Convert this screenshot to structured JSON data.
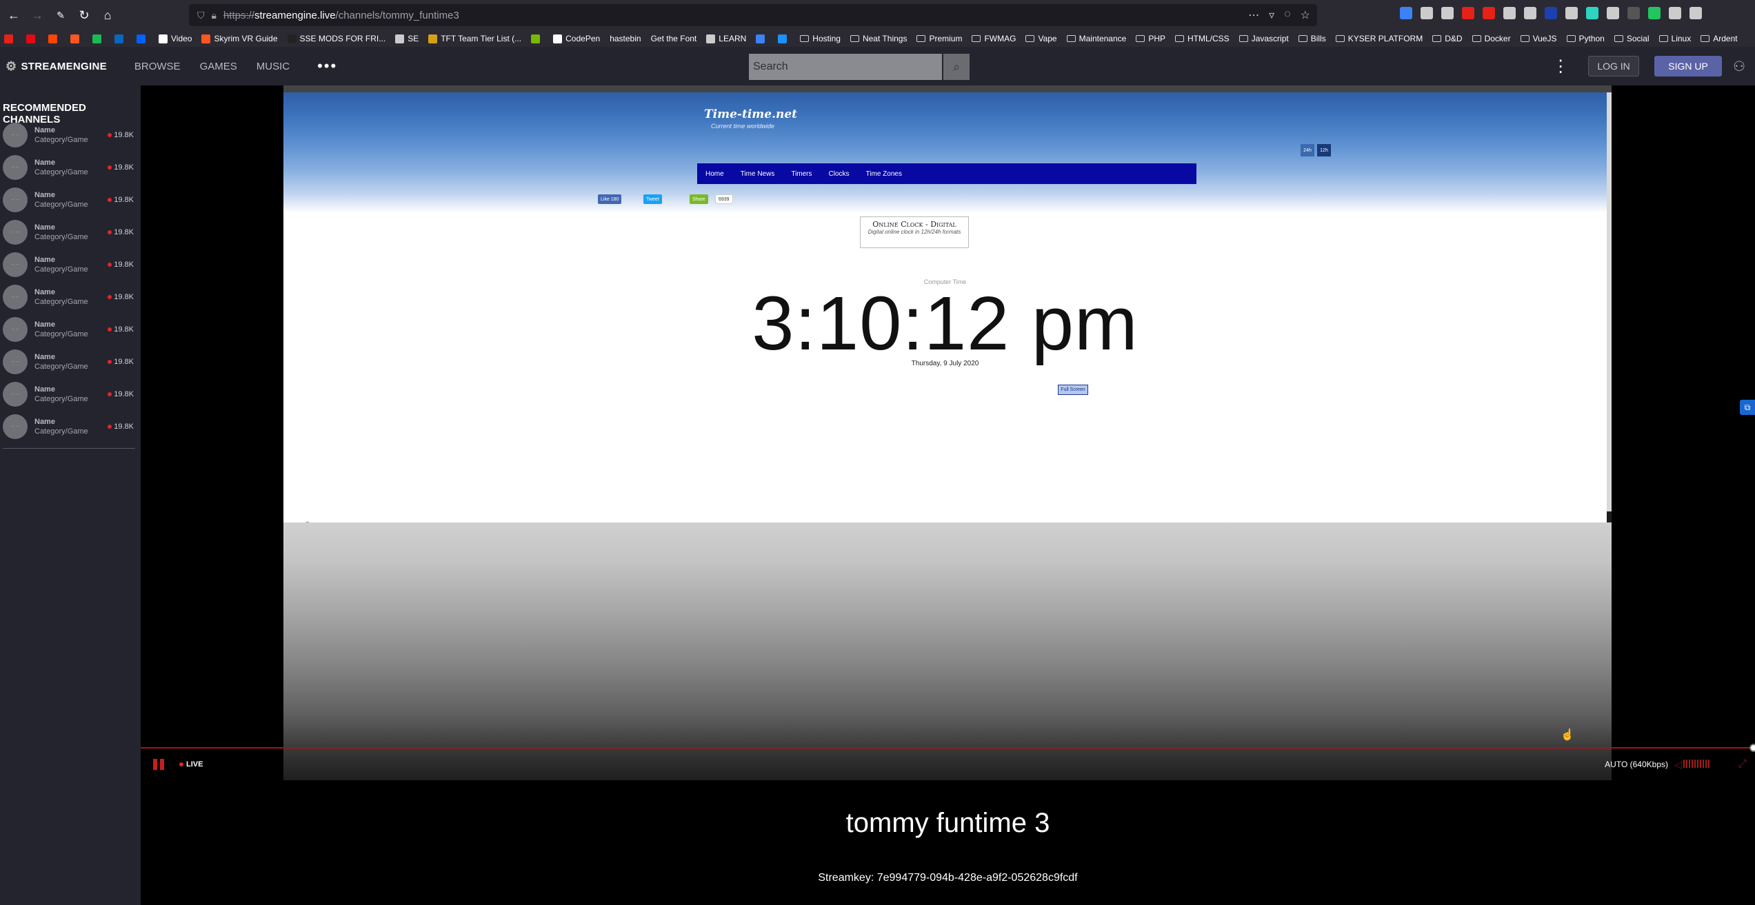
{
  "browser": {
    "url_scheme": "https://",
    "url_host": "streamengine.live",
    "url_path": "/channels/tommy_funtime3",
    "bookmarks": [
      {
        "label": "",
        "type": "icon",
        "color": "#e62117"
      },
      {
        "label": "",
        "type": "icon",
        "color": "#e50914"
      },
      {
        "label": "",
        "type": "icon",
        "color": "#ff4500"
      },
      {
        "label": "",
        "type": "icon",
        "color": "#ff5722"
      },
      {
        "label": "",
        "type": "icon",
        "color": "#1db954"
      },
      {
        "label": "",
        "type": "icon",
        "color": "#0a66c2"
      },
      {
        "label": "",
        "type": "icon",
        "color": "#0061fe"
      },
      {
        "label": "Video",
        "type": "icon",
        "color": "#ffffff"
      },
      {
        "label": "Skyrim VR Guide",
        "type": "icon",
        "color": "#ff5722"
      },
      {
        "label": "SSE MODS FOR FRI...",
        "type": "icon",
        "color": "#222222"
      },
      {
        "label": "SE",
        "type": "icon",
        "color": "#cccccc"
      },
      {
        "label": "TFT Team Tier List (...",
        "type": "icon",
        "color": "#d4a017"
      },
      {
        "label": "",
        "type": "icon",
        "color": "#76b900"
      },
      {
        "label": "CodePen",
        "type": "icon",
        "color": "#ffffff"
      },
      {
        "label": "hastebin",
        "type": "none",
        "color": ""
      },
      {
        "label": "Get the Font",
        "type": "none",
        "color": ""
      },
      {
        "label": "LEARN",
        "type": "icon",
        "color": "#cccccc"
      },
      {
        "label": "",
        "type": "icon",
        "color": "#3b82f6"
      },
      {
        "label": "",
        "type": "icon",
        "color": "#1e90ff"
      },
      {
        "label": "Hosting",
        "type": "folder",
        "color": ""
      },
      {
        "label": "Neat Things",
        "type": "folder",
        "color": ""
      },
      {
        "label": "Premium",
        "type": "folder",
        "color": ""
      },
      {
        "label": "FWMAG",
        "type": "folder",
        "color": ""
      },
      {
        "label": "Vape",
        "type": "folder",
        "color": ""
      },
      {
        "label": "Maintenance",
        "type": "folder",
        "color": ""
      },
      {
        "label": "PHP",
        "type": "folder",
        "color": ""
      },
      {
        "label": "HTML/CSS",
        "type": "folder",
        "color": ""
      },
      {
        "label": "Javascript",
        "type": "folder",
        "color": ""
      },
      {
        "label": "Bills",
        "type": "folder",
        "color": ""
      },
      {
        "label": "KYSER PLATFORM",
        "type": "folder",
        "color": ""
      },
      {
        "label": "D&D",
        "type": "folder",
        "color": ""
      },
      {
        "label": "Docker",
        "type": "folder",
        "color": ""
      },
      {
        "label": "VueJS",
        "type": "folder",
        "color": ""
      },
      {
        "label": "Python",
        "type": "folder",
        "color": ""
      },
      {
        "label": "Social",
        "type": "folder",
        "color": ""
      },
      {
        "label": "Linux",
        "type": "folder",
        "color": ""
      },
      {
        "label": "Ardent",
        "type": "folder",
        "color": ""
      }
    ],
    "extension_colors": [
      "#3b82f6",
      "#cccccc",
      "#cccccc",
      "#e62117",
      "#e62117",
      "#cccccc",
      "#cccccc",
      "#1e40af",
      "#cccccc",
      "#2dd4bf",
      "#cccccc",
      "#555555",
      "#22c55e",
      "#cccccc",
      "#cccccc"
    ]
  },
  "header": {
    "logo": "STREAMENGINE",
    "nav": [
      "BROWSE",
      "GAMES",
      "MUSIC"
    ],
    "search_placeholder": "Search",
    "login_label": "LOG IN",
    "signup_label": "SIGN UP",
    "accent_color": "#5b63a7"
  },
  "sidebar": {
    "title": "RECOMMENDED CHANNELS",
    "channels": [
      {
        "name": "Name",
        "category": "Category/Game",
        "viewers": "19.8K"
      },
      {
        "name": "Name",
        "category": "Category/Game",
        "viewers": "19.8K"
      },
      {
        "name": "Name",
        "category": "Category/Game",
        "viewers": "19.8K"
      },
      {
        "name": "Name",
        "category": "Category/Game",
        "viewers": "19.8K"
      },
      {
        "name": "Name",
        "category": "Category/Game",
        "viewers": "19.8K"
      },
      {
        "name": "Name",
        "category": "Category/Game",
        "viewers": "19.8K"
      },
      {
        "name": "Name",
        "category": "Category/Game",
        "viewers": "19.8K"
      },
      {
        "name": "Name",
        "category": "Category/Game",
        "viewers": "19.8K"
      },
      {
        "name": "Name",
        "category": "Category/Game",
        "viewers": "19.8K"
      },
      {
        "name": "Name",
        "category": "Category/Game",
        "viewers": "19.8K"
      }
    ]
  },
  "captured_page": {
    "logo": "Time-time.net",
    "slogan": "Current time worldwide",
    "toggle_24h": "24h",
    "toggle_12h": "12h",
    "nav": [
      "Home",
      "Time News",
      "Timers",
      "Clocks",
      "Time Zones"
    ],
    "like_label": "Like 180",
    "tweet_label": "Tweet",
    "share_label": "Share",
    "share_count": "6939",
    "box_title": "Online Clock - Digital",
    "box_subtitle": "Digital online clock in 12h/24h formats",
    "timezone_label": "Computer Time",
    "time": "3:10:12 pm",
    "date": "Thursday, 9 July 2020",
    "fullscreen_label": "Full Screen"
  },
  "player": {
    "live_label": "LIVE",
    "quality": "AUTO (640Kbps)",
    "live_color": "#e0262b"
  },
  "stream": {
    "title": "tommy funtime 3",
    "streamkey": "Streamkey: 7e994779-094b-428e-a9f2-052628c9fcdf"
  }
}
